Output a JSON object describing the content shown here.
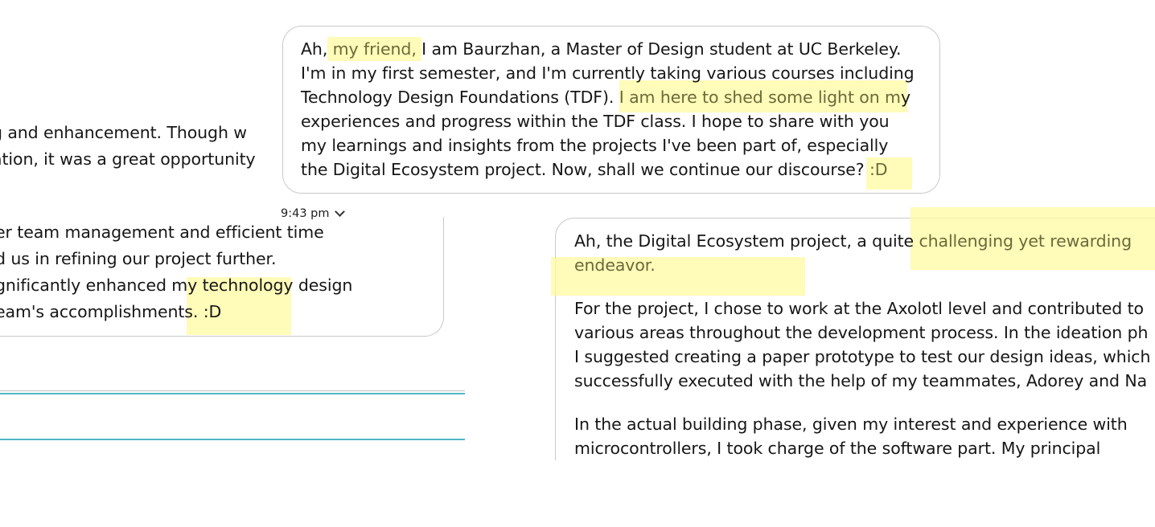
{
  "left_fragment": {
    "top_lines": [
      "g and enhancement. Though w",
      "ation, it was a great opportunity"
    ],
    "bubble_lines": [
      "er team management and efficient time",
      "d us in refining our project further.",
      "gnificantly enhanced my technology design",
      "eam's accomplishments. :D"
    ],
    "highlight_bits": [
      "my technology",
      "nts. :D"
    ]
  },
  "top_message": {
    "lines": [
      [
        "Ah, ",
        "my friend,",
        " I am Baurzhan, a Master of Design student at UC Berkeley."
      ],
      [
        "I'm in my first semester, and I'm currently taking various courses including"
      ],
      [
        "Technology Design Foundations (TDF). ",
        "I am here to shed some light on m",
        "y"
      ],
      [
        "experiences and progress within the TDF class. I hope to share with you"
      ],
      [
        "my learnings and insights from the projects I've been part of, especially"
      ],
      [
        "the Digital Ecosystem project. Now, shall we continue our discourse? ",
        ":D"
      ]
    ],
    "timestamp": "9:43 pm"
  },
  "right_message": {
    "para1": [
      [
        "Ah, the Digital Ecosystem project, a quite ",
        "challenging yet rewarding"
      ],
      [
        "endeavor."
      ]
    ],
    "para2": [
      "For the project, I chose to work at the Axolotl level and contributed to",
      "various areas throughout the development process. In the ideation ph",
      "I suggested creating a paper prototype to test our design ideas, which",
      "successfully executed with the help of my teammates, Adorey and Na"
    ],
    "para3": [
      "In the actual building phase, given my interest and experience with",
      "microcontrollers, I took charge of the software part. My principal"
    ]
  },
  "colors": {
    "highlight": "#fff9a0",
    "border": "#c9c9c9",
    "accent_rule": "#4fb7c4"
  }
}
